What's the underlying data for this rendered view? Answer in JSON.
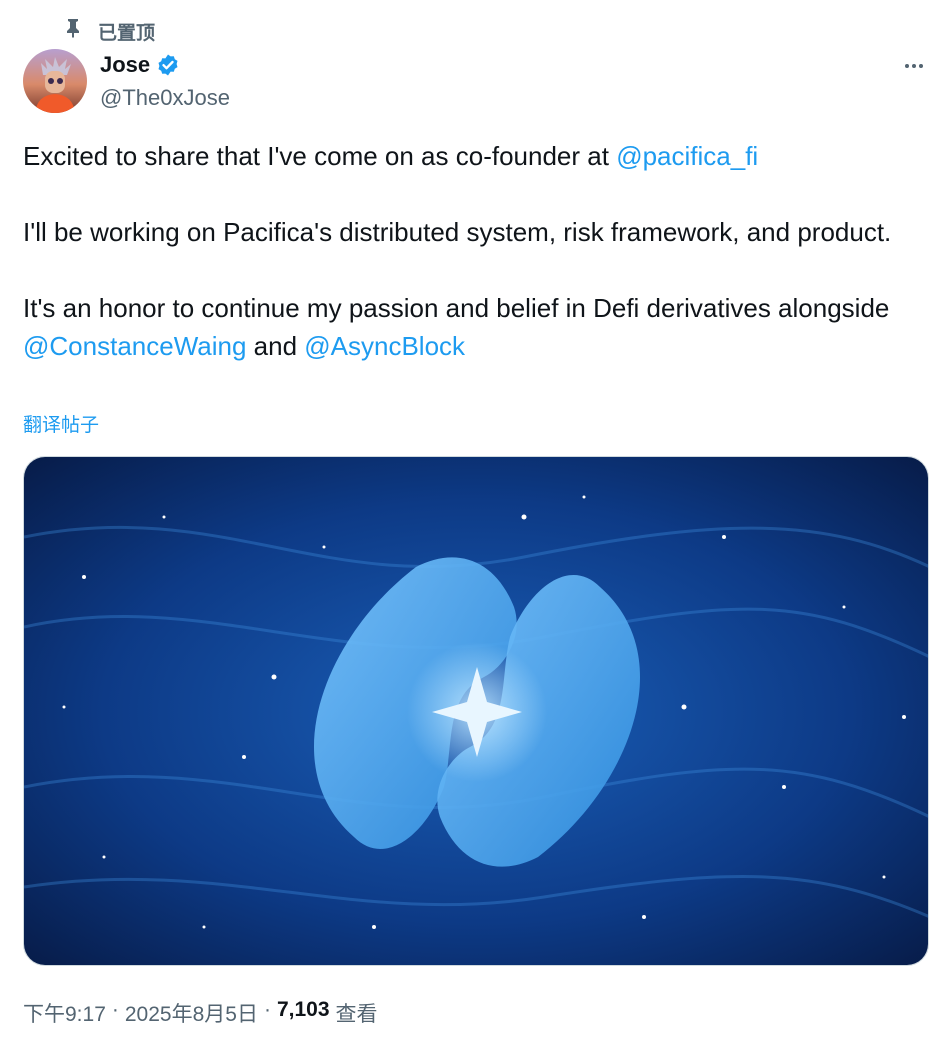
{
  "pinned": {
    "label": "已置顶",
    "icon": "pin-icon"
  },
  "author": {
    "name": "Jose",
    "handle": "@The0xJose",
    "verified_icon": "verified-badge-icon",
    "verified_color": "#1d9bf0"
  },
  "more_icon": "more-options-icon",
  "post": {
    "p1_text": "Excited to share that I've come on as co-founder at ",
    "p1_mention": "@pacifica_fi",
    "p2_text": "I'll be working on Pacifica's distributed system, risk framework, and product.",
    "p3_text": "It's an honor to continue my passion and belief in Defi derivatives alongside ",
    "p3_mention1": "@ConstanceWaing",
    "p3_and": " and ",
    "p3_mention2": "@AsyncBlock"
  },
  "translate_link": "翻译帖子",
  "media": {
    "icon": "pacifica-logo-image"
  },
  "meta": {
    "time": "下午9:17",
    "separator": "·",
    "date": "2025年8月5日",
    "views_count": "7,103",
    "views_label": "查看"
  },
  "colors": {
    "link": "#1d9bf0",
    "secondary": "#536471",
    "text": "#0f1419"
  }
}
